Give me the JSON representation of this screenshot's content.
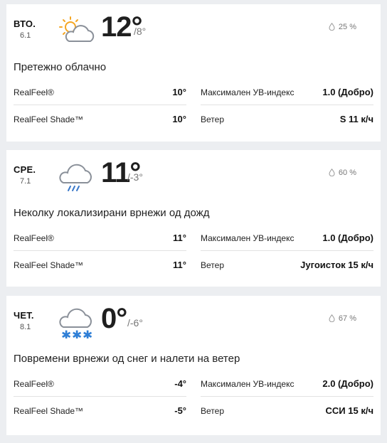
{
  "days": [
    {
      "day": "ВТО.",
      "date": "6.1",
      "icon": "partly-sunny-icon",
      "high": "12°",
      "low": "/8°",
      "precip": "25 %",
      "phrase": "Претежно облачно",
      "realfeel_label": "RealFeel®",
      "realfeel": "10°",
      "realfeel_shade_label": "RealFeel Shade™",
      "realfeel_shade": "10°",
      "uv_label": "Максимален УВ-индекс",
      "uv": "1.0 (Добро)",
      "wind_label": "Ветер",
      "wind": "S 11 к/ч"
    },
    {
      "day": "СРЕ.",
      "date": "7.1",
      "icon": "rain-cloud-icon",
      "high": "11°",
      "low": "/-3°",
      "precip": "60 %",
      "phrase": "Неколку локализирани врнежи од дожд",
      "realfeel_label": "RealFeel®",
      "realfeel": "11°",
      "realfeel_shade_label": "RealFeel Shade™",
      "realfeel_shade": "11°",
      "uv_label": "Максимален УВ-индекс",
      "uv": "1.0 (Добро)",
      "wind_label": "Ветер",
      "wind": "Југоисток 15 к/ч"
    },
    {
      "day": "ЧЕТ.",
      "date": "8.1",
      "icon": "snow-cloud-icon",
      "high": "0°",
      "low": "/-6°",
      "precip": "67 %",
      "phrase": "Повремени врнежи од снег и налети на ветер",
      "realfeel_label": "RealFeel®",
      "realfeel": "-4°",
      "realfeel_shade_label": "RealFeel Shade™",
      "realfeel_shade": "-5°",
      "uv_label": "Максимален УВ-индекс",
      "uv": "2.0 (Добро)",
      "wind_label": "Ветер",
      "wind": "ССИ 15 к/ч"
    }
  ],
  "colors": {
    "sun": "#f5a623",
    "cloud_outline": "#8a9099",
    "rain": "#3a78c9",
    "snow": "#2f7fd6",
    "background": "#eceef1"
  }
}
